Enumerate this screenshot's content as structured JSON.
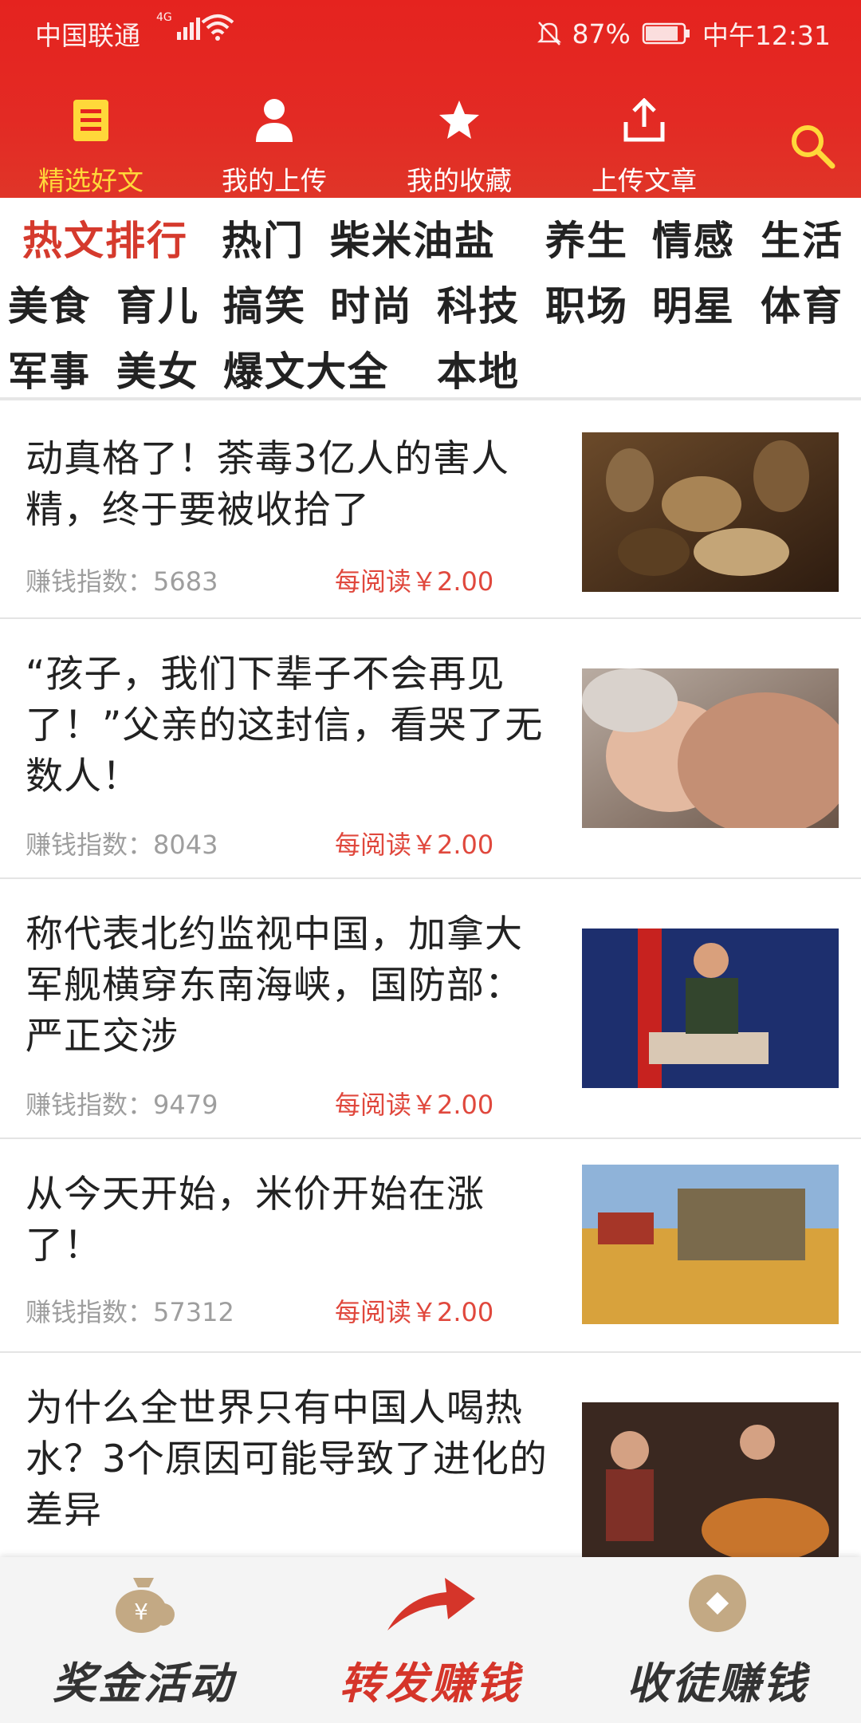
{
  "status": {
    "carrier": "中国联通",
    "network": "4G",
    "battery": "87%",
    "time": "中午12:31"
  },
  "nav": [
    {
      "label": "精选好文",
      "icon": "document-icon",
      "active": true
    },
    {
      "label": "我的上传",
      "icon": "user-icon",
      "active": false
    },
    {
      "label": "我的收藏",
      "icon": "star-icon",
      "active": false
    },
    {
      "label": "上传文章",
      "icon": "upload-icon",
      "active": false
    }
  ],
  "categories": [
    "热文排行",
    "热门",
    "柴米油盐",
    "养生",
    "情感",
    "生活",
    "美食",
    "育儿",
    "搞笑",
    "时尚",
    "科技",
    "职场",
    "明星",
    "体育",
    "军事",
    "美女",
    "爆文大全",
    "本地"
  ],
  "articles": [
    {
      "title": "动真格了！荼毒3亿人的害人精，终于要被收拾了",
      "index": "赚钱指数：5683",
      "price": "每阅读￥2.00"
    },
    {
      "title": "“孩子，我们下辈子不会再见了！”父亲的这封信，看哭了无数人！",
      "index": "赚钱指数：8043",
      "price": "每阅读￥2.00"
    },
    {
      "title": "称代表北约监视中国，加拿大军舰横穿东南海峡，国防部：严正交涉",
      "index": "赚钱指数：9479",
      "price": "每阅读￥2.00"
    },
    {
      "title": "从今天开始，米价开始在涨了！",
      "index": "赚钱指数：57312",
      "price": "每阅读￥2.00"
    },
    {
      "title": "为什么全世界只有中国人喝热水？3个原因可能导致了进化的差异",
      "index": "",
      "price": ""
    }
  ],
  "bottom": [
    {
      "label": "奖金活动",
      "icon": "money-bag-icon",
      "color": "#333333"
    },
    {
      "label": "转发赚钱",
      "icon": "share-arrow-icon",
      "color": "#d5352a"
    },
    {
      "label": "收徒赚钱",
      "icon": "coin-icon",
      "color": "#333333"
    }
  ],
  "colors": {
    "header": "#e5231f",
    "active_nav": "#ffd83a",
    "active_cat": "#d53a2d",
    "price": "#e0483d"
  }
}
